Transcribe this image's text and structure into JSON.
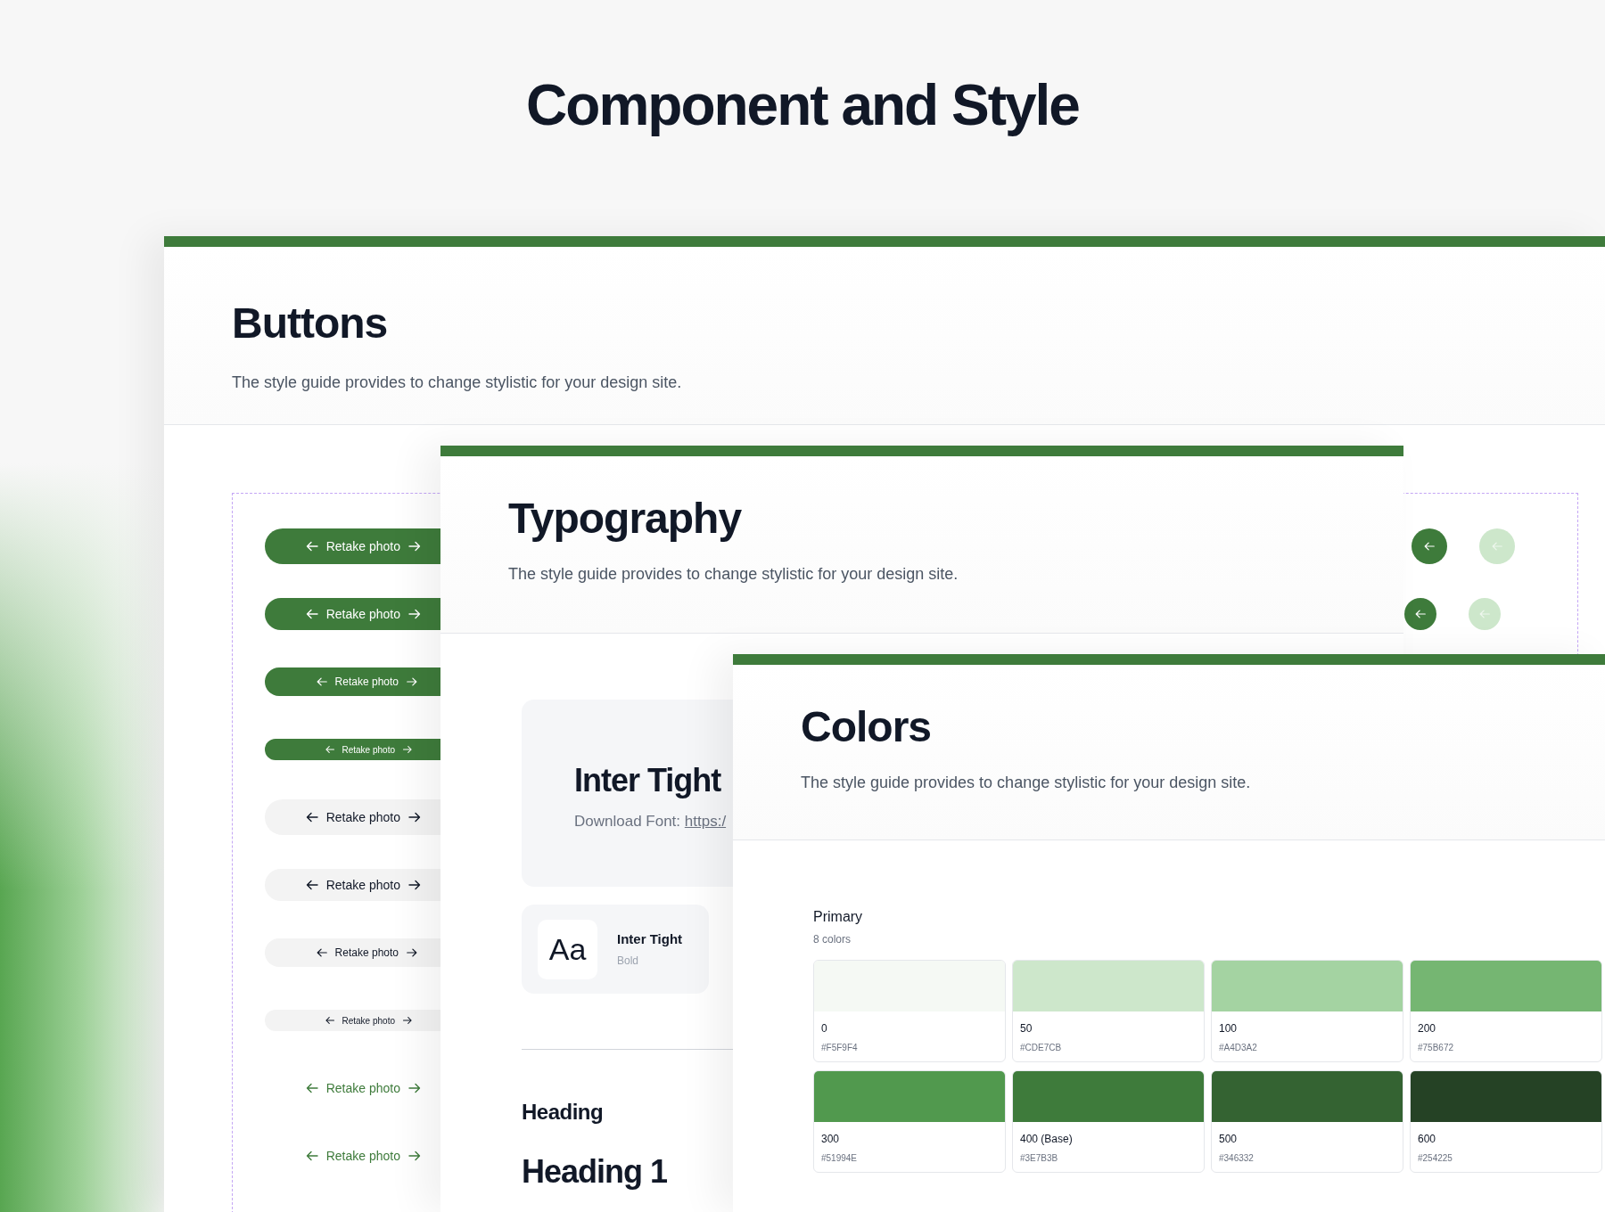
{
  "page_title": "Component and Style",
  "buttons_panel": {
    "title": "Buttons",
    "description": "The style guide provides to change stylistic for your design site.",
    "pill_buttons": [
      {
        "label": "Retake photo",
        "kind": "filled"
      },
      {
        "label": "Retake photo",
        "kind": "filled"
      },
      {
        "label": "Retake photo",
        "kind": "filled"
      },
      {
        "label": "Retake photo",
        "kind": "filled"
      },
      {
        "label": "Retake photo",
        "kind": "light"
      },
      {
        "label": "Retake photo",
        "kind": "light"
      },
      {
        "label": "Retake photo",
        "kind": "light"
      },
      {
        "label": "Retake photo",
        "kind": "light"
      },
      {
        "label": "Retake photo",
        "kind": "text"
      },
      {
        "label": "Retake photo",
        "kind": "text"
      }
    ],
    "icon_buttons": [
      {
        "disabled": false
      },
      {
        "disabled": true
      },
      {
        "disabled": false
      },
      {
        "disabled": true
      }
    ]
  },
  "typography_panel": {
    "title": "Typography",
    "description": "The style guide provides to change stylistic for your design site.",
    "font_card": {
      "name": "Inter Tight",
      "download_label": "Download Font:",
      "download_link": "https:/"
    },
    "font_style_card": {
      "sample": "Aa",
      "name": "Inter Tight",
      "weight": "Bold"
    },
    "headings": [
      {
        "text": "Heading",
        "kind": "label"
      },
      {
        "text": "Heading 1",
        "kind": "h1"
      }
    ]
  },
  "colors_panel": {
    "title": "Colors",
    "description": "The style guide provides to change stylistic for your design site.",
    "palette": {
      "name": "Primary",
      "count": "8 colors",
      "swatches": [
        {
          "name": "0",
          "hex": "#F5F9F4",
          "color": "#f5f9f4"
        },
        {
          "name": "50",
          "hex": "#CDE7CB",
          "color": "#cde7cb"
        },
        {
          "name": "100",
          "hex": "#A4D3A2",
          "color": "#a4d3a2"
        },
        {
          "name": "200",
          "hex": "#75B672",
          "color": "#75b672"
        },
        {
          "name": "300",
          "hex": "#51994E",
          "color": "#51994e"
        },
        {
          "name": "400 (Base)",
          "hex": "#3E7B3B",
          "color": "#3e7b3b"
        },
        {
          "name": "500",
          "hex": "#346332",
          "color": "#346332"
        },
        {
          "name": "600",
          "hex": "#254225",
          "color": "#254225"
        }
      ]
    }
  }
}
